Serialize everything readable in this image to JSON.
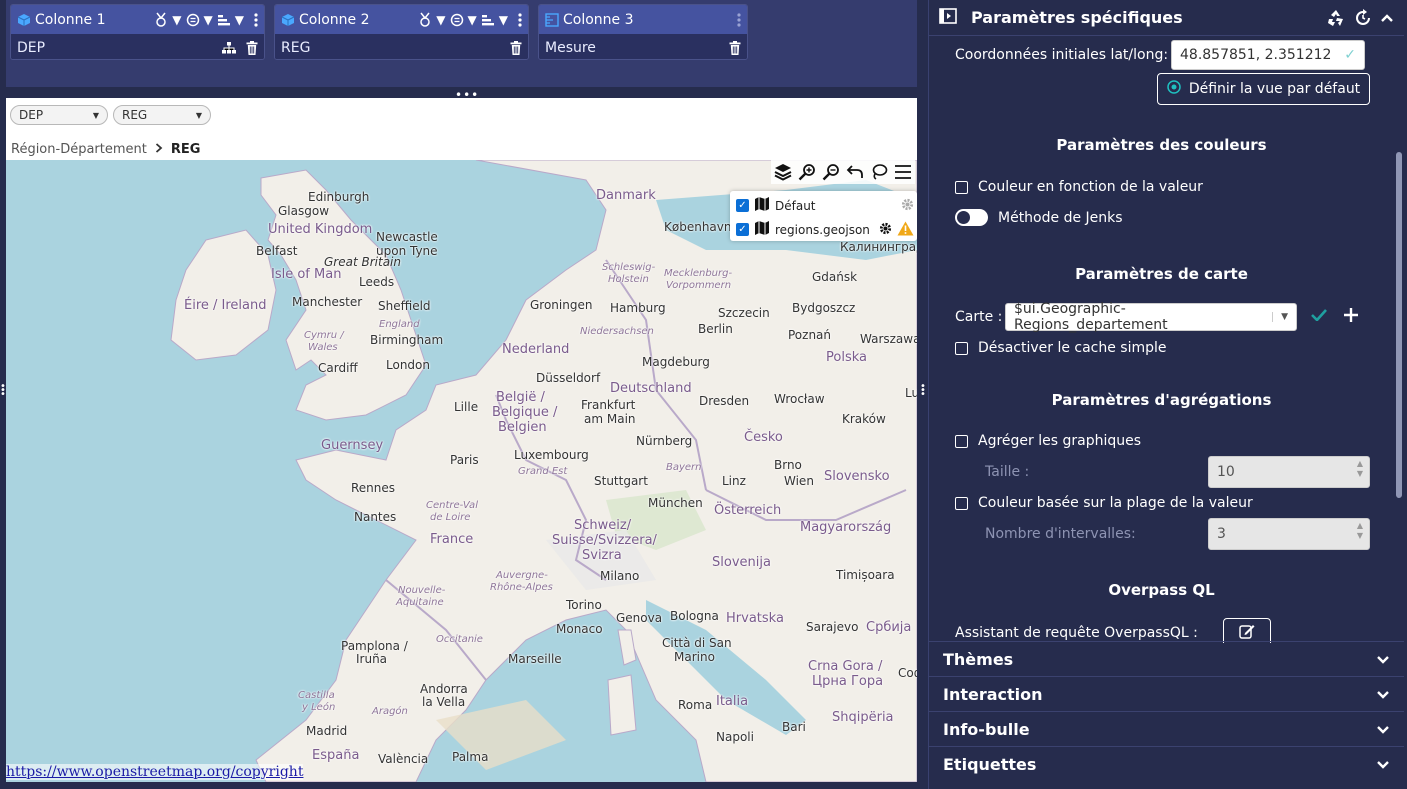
{
  "columns": [
    {
      "header": "Colonne 1",
      "value": "DEP"
    },
    {
      "header": "Colonne 2",
      "value": "REG"
    },
    {
      "header": "Colonne 3",
      "value": "Mesure"
    }
  ],
  "filters": [
    {
      "label": "DEP"
    },
    {
      "label": "REG"
    }
  ],
  "breadcrumb": {
    "parent": "Région-Département",
    "current": "REG"
  },
  "layers": [
    {
      "name": "Défaut"
    },
    {
      "name": "regions.geojson"
    }
  ],
  "map": {
    "attribution": "https://www.openstreetmap.org/copyright",
    "labels": {
      "edinburgh": "Edinburgh",
      "glasgow": "Glasgow",
      "uk": "United Kingdom",
      "newcastle1": "Newcastle",
      "newcastle2": "upon Tyne",
      "belfast": "Belfast",
      "great_britain": "Great Britain",
      "isle_of_man": "Isle of Man",
      "leeds": "Leeds",
      "eire": "Éire / Ireland",
      "manchester": "Manchester",
      "sheffield": "Sheffield",
      "england": "England",
      "cymru": "Cymru /",
      "wales": "Wales",
      "birmingham": "Birmingham",
      "cardiff": "Cardiff",
      "london": "London",
      "guernsey": "Guernsey",
      "lille": "Lille",
      "paris": "Paris",
      "rennes": "Rennes",
      "nantes": "Nantes",
      "france": "France",
      "cvl1": "Centre-Val",
      "cvl2": "de Loire",
      "na1": "Nouvelle-",
      "na2": "Aquitaine",
      "ara1": "Auvergne-",
      "ara2": "Rhône-Alpes",
      "occitanie": "Occitanie",
      "marseille": "Marseille",
      "monaco": "Monaco",
      "pamplona1": "Pamplona /",
      "pamplona2": "Iruña",
      "andorra1": "Andorra",
      "andorra2": "la Vella",
      "cyl1": "Castilla",
      "cyl2": "y León",
      "aragon": "Aragón",
      "madrid": "Madrid",
      "espana": "España",
      "valencia": "València",
      "palma": "Palma",
      "denmark": "Danmark",
      "kobenhavn": "København",
      "kaliningrad": "Калининград",
      "gdansk": "Gdańsk",
      "schleswig1": "Schleswig-",
      "schleswig2": "Holstein",
      "meck1": "Mecklenburg-",
      "meck2": "Vorpommern",
      "groningen": "Groningen",
      "hamburg": "Hamburg",
      "szczecin": "Szczecin",
      "bydgoszcz": "Bydgoszcz",
      "niedersachsen": "Niedersachsen",
      "berlin": "Berlin",
      "poznan": "Poznań",
      "warszawa": "Warszawa",
      "nederland": "Nederland",
      "magdeburg": "Magdeburg",
      "polska": "Polska",
      "dusseldorf": "Düsseldorf",
      "deutschland": "Deutschland",
      "belgie1": "België /",
      "belgie2": "Belgique /",
      "belgie3": "Belgien",
      "frankfurt1": "Frankfurt",
      "frankfurt2": "am Main",
      "dresden": "Dresden",
      "wroclaw": "Wrocław",
      "krakow": "Kraków",
      "luxembourg": "Luxembourg",
      "grand_est": "Grand Est",
      "nurnberg": "Nürnberg",
      "cesko": "Česko",
      "bayern": "Bayern",
      "brno": "Brno",
      "stuttgart": "Stuttgart",
      "linz": "Linz",
      "wien": "Wien",
      "slovensko": "Slovensko",
      "munchen": "München",
      "osterreich": "Österreich",
      "schweiz1": "Schweiz/",
      "schweiz2": "Suisse/Svizzera/",
      "schweiz3": "Svizra",
      "magyar": "Magyarország",
      "milano": "Milano",
      "slovenija": "Slovenija",
      "timisoara": "Timișoara",
      "torino": "Torino",
      "genova": "Genova",
      "bologna": "Bologna",
      "hrvatska": "Hrvatska",
      "sarajevo": "Sarajevo",
      "srbija": "Србија",
      "citta1": "Città di San",
      "citta2": "Marino",
      "crna1": "Crna Gora /",
      "crna2": "Црна Гора",
      "italia": "Italia",
      "roma": "Roma",
      "shqiperia": "Shqipëria",
      "napoli": "Napoli",
      "bari": "Bari",
      "lu": "Lu",
      "sofi": "Соф"
    }
  },
  "settings": {
    "header_title": "Paramètres spécifiques",
    "coords_label": "Coordonnées initiales lat/long:",
    "coords_value": "48.857851, 2.351212",
    "default_view_button": "Définir la vue par défaut",
    "colors_title": "Paramètres des couleurs",
    "color_by_value": "Couleur en fonction de la valeur",
    "jenks_method": "Méthode de Jenks",
    "map_title": "Paramètres de carte",
    "map_label": "Carte :",
    "map_value": "$ui.Geographic-Regions_departement",
    "disable_cache": "Désactiver le cache simple",
    "agg_title": "Paramètres d'agrégations",
    "agg_charts": "Agréger les graphiques",
    "size_label": "Taille :",
    "size_value": "10",
    "color_range": "Couleur basée sur la plage de la valeur",
    "intervals_label": "Nombre d'intervalles:",
    "intervals_value": "3",
    "overpass_title": "Overpass QL",
    "overpass_assistant": "Assistant de requête OverpassQL :"
  },
  "accordion": [
    "Thèmes",
    "Interaction",
    "Info-bulle",
    "Etiquettes"
  ],
  "colors": {
    "background": "#262c4d",
    "column_header": "#4553a0",
    "accent_check": "#1fa0a0",
    "sea": "#aad3df",
    "land": "#f2efe9"
  }
}
